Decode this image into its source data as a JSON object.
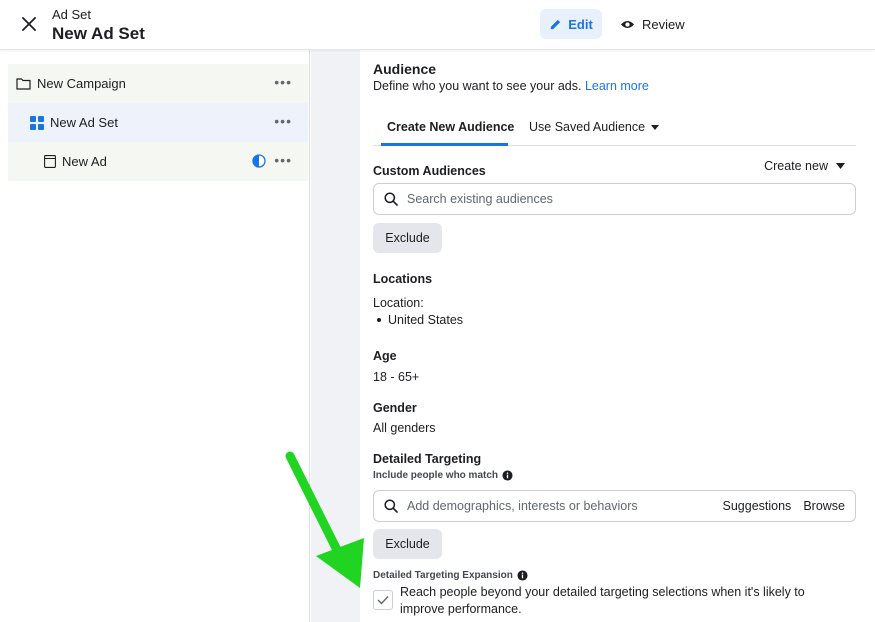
{
  "header": {
    "crumb": "Ad Set",
    "title": "New Ad Set",
    "edit_label": "Edit",
    "review_label": "Review"
  },
  "sidebar": {
    "items": [
      {
        "label": "New Campaign",
        "icon": "folder-icon"
      },
      {
        "label": "New Ad Set",
        "icon": "grid-icon"
      },
      {
        "label": "New Ad",
        "icon": "page-icon"
      }
    ]
  },
  "audience": {
    "title": "Audience",
    "description": "Define who you want to see your ads.",
    "learn_more": "Learn more",
    "tabs": [
      "Create New Audience",
      "Use Saved Audience"
    ],
    "custom_audiences": {
      "label": "Custom Audiences",
      "create_new": "Create new",
      "search_placeholder": "Search existing audiences",
      "exclude": "Exclude"
    },
    "locations": {
      "label": "Locations",
      "location_label": "Location:",
      "items": [
        "United States"
      ]
    },
    "age": {
      "label": "Age",
      "value": "18 - 65+"
    },
    "gender": {
      "label": "Gender",
      "value": "All genders"
    },
    "detailed_targeting": {
      "label": "Detailed Targeting",
      "sub": "Include people who match",
      "search_placeholder": "Add demographics, interests or behaviors",
      "suggestions": "Suggestions",
      "browse": "Browse",
      "exclude": "Exclude",
      "expansion_label": "Detailed Targeting Expansion",
      "expansion_text": "Reach people beyond your detailed targeting selections when it's likely to improve performance."
    }
  },
  "colors": {
    "accent": "#1b74e4",
    "arrow": "#22d422"
  }
}
